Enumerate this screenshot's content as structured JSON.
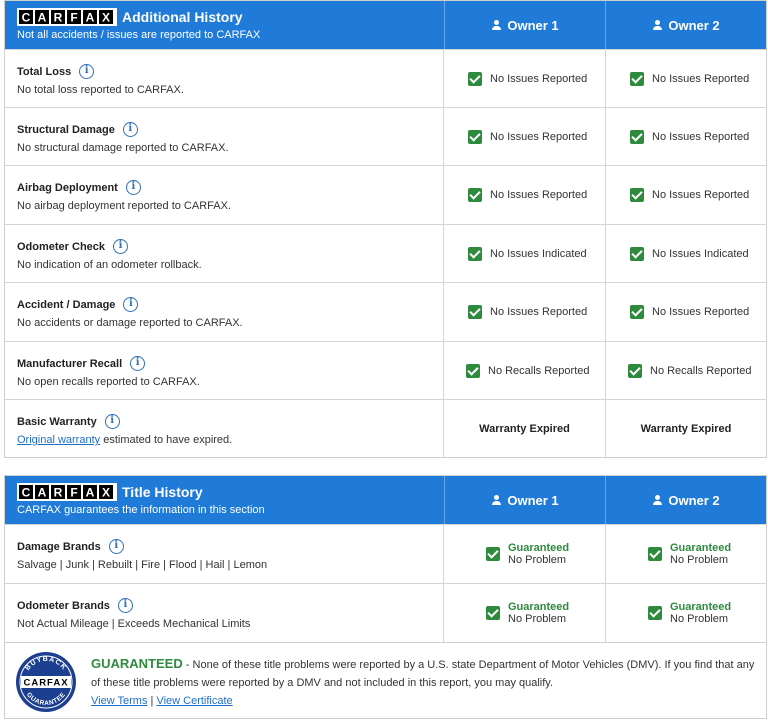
{
  "brand": {
    "logo_text": "CARFAX",
    "header_bg": "#1f7ad8",
    "check_color": "#2e8b3e",
    "link_color": "#1f6ec9"
  },
  "additional_history": {
    "title": "Additional History",
    "subtitle": "Not all accidents / issues are reported to CARFAX",
    "owner1": "Owner 1",
    "owner2": "Owner 2",
    "rows": [
      {
        "title": "Total Loss",
        "desc": "No total loss reported to CARFAX.",
        "o1": "No Issues Reported",
        "o2": "No Issues Reported"
      },
      {
        "title": "Structural Damage",
        "desc": "No structural damage reported to CARFAX.",
        "o1": "No Issues Reported",
        "o2": "No Issues Reported"
      },
      {
        "title": "Airbag Deployment",
        "desc": "No airbag deployment reported to CARFAX.",
        "o1": "No Issues Reported",
        "o2": "No Issues Reported"
      },
      {
        "title": "Odometer Check",
        "desc": "No indication of an odometer rollback.",
        "o1": "No Issues Indicated",
        "o2": "No Issues Indicated"
      },
      {
        "title": "Accident / Damage",
        "desc": "No accidents or damage reported to CARFAX.",
        "o1": "No Issues Reported",
        "o2": "No Issues Reported"
      },
      {
        "title": "Manufacturer Recall",
        "desc": "No open recalls reported to CARFAX.",
        "o1": "No Recalls Reported",
        "o2": "No Recalls Reported"
      }
    ],
    "warranty": {
      "title": "Basic Warranty",
      "link": "Original warranty",
      "desc_rest": " estimated to have expired.",
      "o1": "Warranty Expired",
      "o2": "Warranty Expired"
    }
  },
  "title_history": {
    "title": "Title History",
    "subtitle": "CARFAX guarantees the information in this section",
    "owner1": "Owner 1",
    "owner2": "Owner 2",
    "rows": [
      {
        "title": "Damage Brands",
        "desc": "Salvage | Junk | Rebuilt | Fire | Flood | Hail | Lemon",
        "status": "Guaranteed",
        "sub": "No Problem"
      },
      {
        "title": "Odometer Brands",
        "desc": "Not Actual Mileage | Exceeds Mechanical Limits",
        "status": "Guaranteed",
        "sub": "No Problem"
      }
    ]
  },
  "guarantee": {
    "seal_top": "BUYBACK",
    "seal_mid": "CARFAX",
    "seal_bottom": "GUARANTEE",
    "heading": "GUARANTEED",
    "text": " - None of these title problems were reported by a U.S. state Department of Motor Vehicles (DMV). If you find that any of these title problems were reported by a DMV and not included in this report, you may qualify.",
    "view_terms": "View Terms",
    "sep": " | ",
    "view_certificate": "View Certificate"
  }
}
